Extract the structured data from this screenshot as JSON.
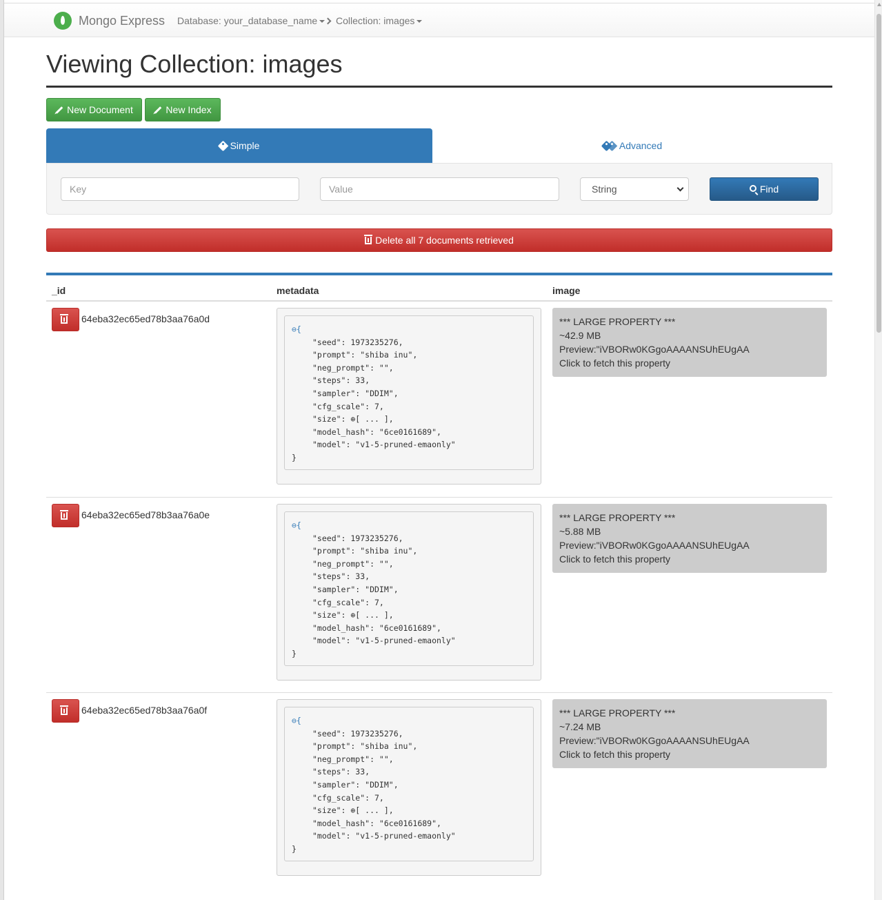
{
  "navbar": {
    "brand": "Mongo Express",
    "database_crumb": "Database: your_database_name",
    "collection_crumb": "Collection: images"
  },
  "page": {
    "title": "Viewing Collection: images"
  },
  "toolbar": {
    "new_document": "New Document",
    "new_index": "New Index"
  },
  "tabs": {
    "simple": "Simple",
    "advanced": "Advanced"
  },
  "search": {
    "key_placeholder": "Key",
    "value_placeholder": "Value",
    "type_selected": "String",
    "find_label": "Find"
  },
  "delete_all_label": "Delete all 7 documents retrieved",
  "table": {
    "columns": [
      "_id",
      "metadata",
      "image"
    ],
    "rows": [
      {
        "id": "64eba32ec65ed78b3aa76a0d",
        "metadata": {
          "open": "⊖{",
          "lines": [
            "\"seed\": 1973235276,",
            "\"prompt\": \"shiba inu\",",
            "\"neg_prompt\": \"\",",
            "\"steps\": 33,",
            "\"sampler\": \"DDIM\",",
            "\"cfg_scale\": 7,",
            "\"size\": ⊕[ ... ],",
            "\"model_hash\": \"6ce0161689\",",
            "\"model\": \"v1-5-pruned-emaonly\""
          ],
          "close": "}"
        },
        "image": {
          "line1": "*** LARGE PROPERTY ***",
          "line2": "~42.9 MB",
          "line3": "Preview:\"iVBORw0KGgoAAAANSUhEUgAA",
          "line4": "Click to fetch this property"
        }
      },
      {
        "id": "64eba32ec65ed78b3aa76a0e",
        "metadata": {
          "open": "⊖{",
          "lines": [
            "\"seed\": 1973235276,",
            "\"prompt\": \"shiba inu\",",
            "\"neg_prompt\": \"\",",
            "\"steps\": 33,",
            "\"sampler\": \"DDIM\",",
            "\"cfg_scale\": 7,",
            "\"size\": ⊕[ ... ],",
            "\"model_hash\": \"6ce0161689\",",
            "\"model\": \"v1-5-pruned-emaonly\""
          ],
          "close": "}"
        },
        "image": {
          "line1": "*** LARGE PROPERTY ***",
          "line2": "~5.88 MB",
          "line3": "Preview:\"iVBORw0KGgoAAAANSUhEUgAA",
          "line4": "Click to fetch this property"
        }
      },
      {
        "id": "64eba32ec65ed78b3aa76a0f",
        "metadata": {
          "open": "⊖{",
          "lines": [
            "\"seed\": 1973235276,",
            "\"prompt\": \"shiba inu\",",
            "\"neg_prompt\": \"\",",
            "\"steps\": 33,",
            "\"sampler\": \"DDIM\",",
            "\"cfg_scale\": 7,",
            "\"size\": ⊕[ ... ],",
            "\"model_hash\": \"6ce0161689\",",
            "\"model\": \"v1-5-pruned-emaonly\""
          ],
          "close": "}"
        },
        "image": {
          "line1": "*** LARGE PROPERTY ***",
          "line2": "~7.24 MB",
          "line3": "Preview:\"iVBORw0KGgoAAAANSUhEUgAA",
          "line4": "Click to fetch this property"
        }
      }
    ]
  },
  "colors": {
    "primary": "#337ab7",
    "success": "#5cb85c",
    "danger": "#d9534f",
    "large_property_bg": "#cccccc"
  }
}
